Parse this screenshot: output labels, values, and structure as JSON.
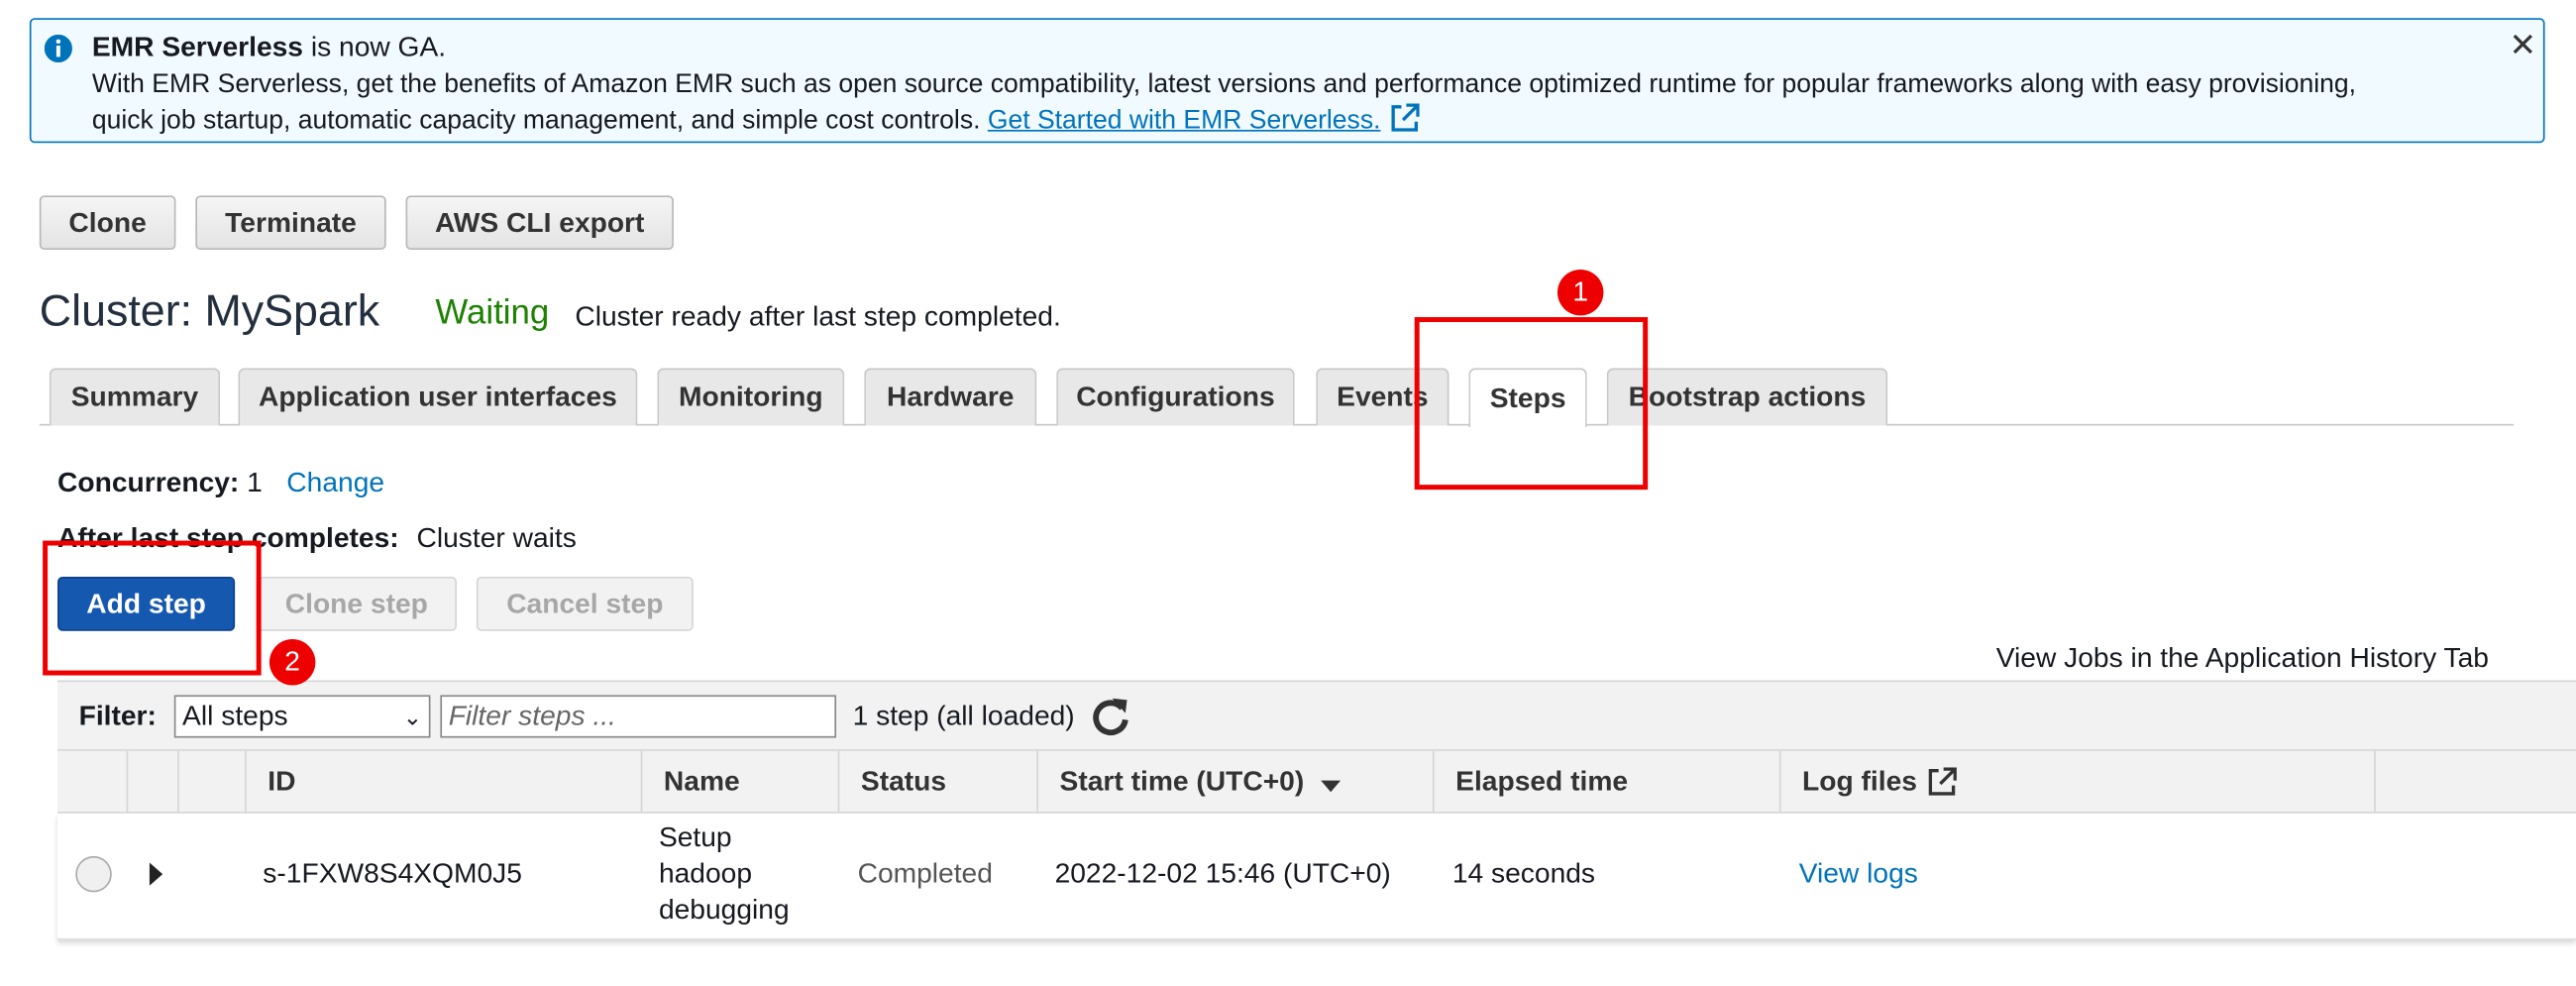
{
  "banner": {
    "title": "EMR Serverless",
    "title_suffix": " is now GA.",
    "line2": "With EMR Serverless, get the benefits of Amazon EMR such as open source compatibility, latest versions and performance optimized runtime for popular frameworks along with easy provisioning,",
    "line3": "quick job startup, automatic capacity management, and simple cost controls. ",
    "link": "Get Started with EMR Serverless.",
    "close": "✕"
  },
  "toolbar": {
    "clone": "Clone",
    "terminate": "Terminate",
    "cli_export": "AWS CLI export"
  },
  "cluster": {
    "title": "Cluster: MySpark",
    "state": "Waiting",
    "message": "Cluster ready after last step completed."
  },
  "tabs": [
    {
      "label": "Summary"
    },
    {
      "label": "Application user interfaces"
    },
    {
      "label": "Monitoring"
    },
    {
      "label": "Hardware"
    },
    {
      "label": "Configurations"
    },
    {
      "label": "Events"
    },
    {
      "label": "Steps"
    },
    {
      "label": "Bootstrap actions"
    }
  ],
  "steps": {
    "concurrency_label": "Concurrency:",
    "concurrency_value": "1",
    "change_link": "Change",
    "after_label": "After last step completes:",
    "after_value": "Cluster waits",
    "add_step": "Add step",
    "clone_step": "Clone step",
    "cancel_step": "Cancel step",
    "history_link": "View Jobs in the Application History Tab"
  },
  "filter": {
    "label": "Filter:",
    "selected": "All steps",
    "placeholder": "Filter steps ...",
    "count": "1 step (all loaded)"
  },
  "table": {
    "headers": {
      "id": "ID",
      "name": "Name",
      "status": "Status",
      "start": "Start time (UTC+0)",
      "elapsed": "Elapsed time",
      "logs": "Log files"
    },
    "rows": [
      {
        "id": "s-1FXW8S4XQM0J5",
        "name": "Setup hadoop debugging",
        "status": "Completed",
        "start": "2022-12-02 15:46 (UTC+0)",
        "elapsed": "14 seconds",
        "logs": "View logs"
      }
    ]
  },
  "annotations": {
    "badge1": "1",
    "badge2": "2",
    "color": "#ee0000"
  },
  "colors": {
    "primary": "#1558b0",
    "link": "#0073bb",
    "status_waiting": "#1d8102"
  }
}
